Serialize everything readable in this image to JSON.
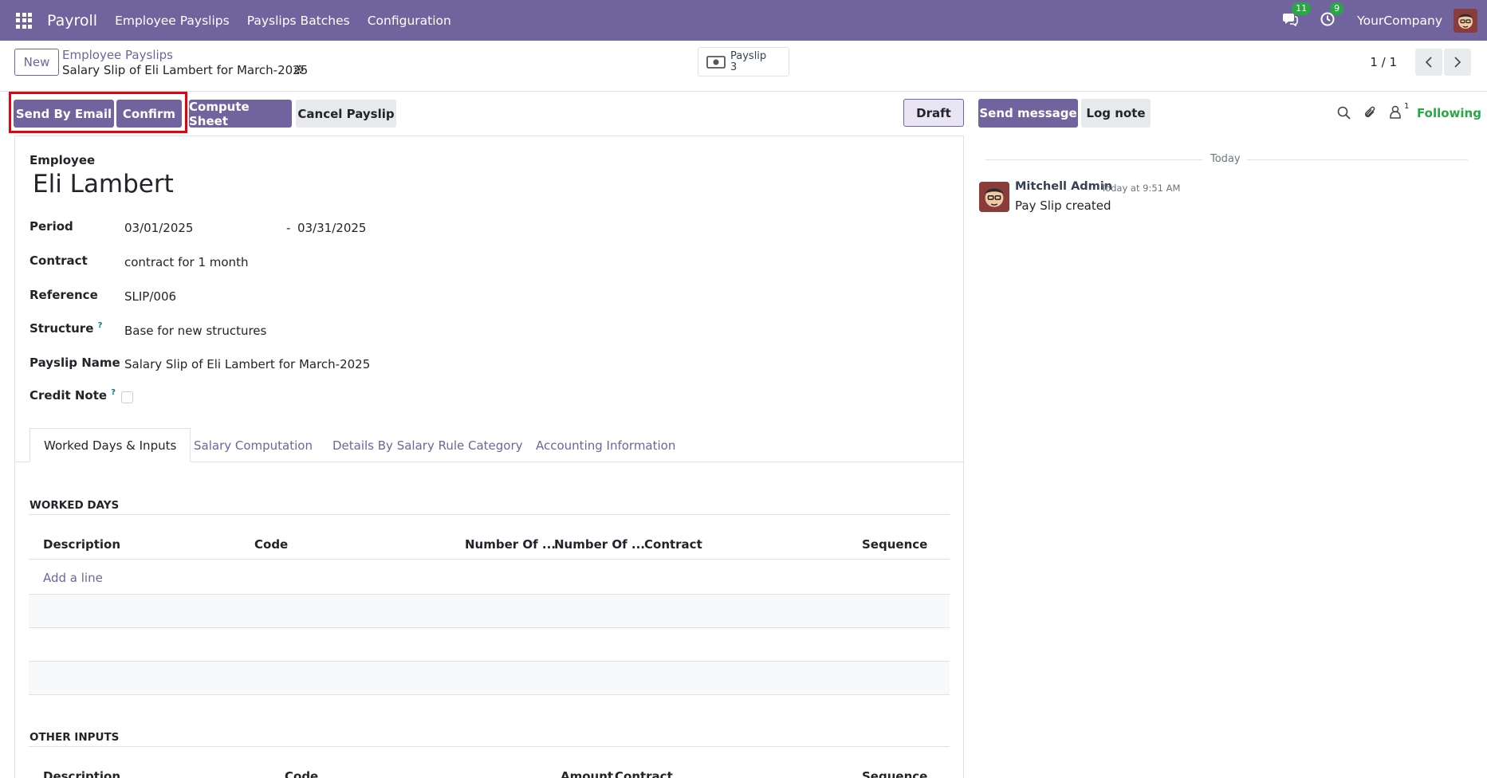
{
  "navbar": {
    "brand": "Payroll",
    "menu": [
      "Employee Payslips",
      "Payslips Batches",
      "Configuration"
    ],
    "messages_count": "11",
    "activities_count": "9",
    "company": "YourCompany"
  },
  "control": {
    "new_label": "New",
    "breadcrumb_parent": "Employee Payslips",
    "breadcrumb_current": "Salary Slip of Eli Lambert for March-2025",
    "smart_button_label": "Payslip",
    "smart_button_count": "3",
    "pager": "1 / 1"
  },
  "actions": {
    "send_by_email": "Send By Email",
    "confirm": "Confirm",
    "compute_sheet": "Compute Sheet",
    "cancel_payslip": "Cancel Payslip",
    "status": "Draft"
  },
  "form": {
    "employee_label": "Employee",
    "employee_name": "Eli Lambert",
    "period_label": "Period",
    "period_from": "03/01/2025",
    "period_sep": "-",
    "period_to": "03/31/2025",
    "contract_label": "Contract",
    "contract_value": "contract for 1 month",
    "reference_label": "Reference",
    "reference_value": "SLIP/006",
    "structure_label": "Structure",
    "structure_value": "Base for new structures",
    "payslip_name_label": "Payslip Name",
    "payslip_name_value": "Salary Slip of Eli Lambert for March-2025",
    "credit_note_label": "Credit Note",
    "help_mark": "?"
  },
  "tabs": [
    "Worked Days & Inputs",
    "Salary Computation",
    "Details By Salary Rule Category",
    "Accounting Information"
  ],
  "worked_days": {
    "title": "WORKED DAYS",
    "columns": [
      "Description",
      "Code",
      "Number Of ...",
      "Number Of ...",
      "Contract",
      "Sequence"
    ],
    "add_line": "Add a line"
  },
  "other_inputs": {
    "title": "OTHER INPUTS",
    "columns": [
      "Description",
      "Code",
      "Amount",
      "Contract",
      "Sequence"
    ]
  },
  "chatter": {
    "send_message": "Send message",
    "log_note": "Log note",
    "followers_count": "1",
    "following": "Following",
    "today": "Today",
    "author": "Mitchell Admin",
    "time": "Today at 9:51 AM",
    "body": "Pay Slip created"
  },
  "colors": {
    "brand": "#71639e",
    "highlight": "#e8000b",
    "success": "#28a745"
  }
}
